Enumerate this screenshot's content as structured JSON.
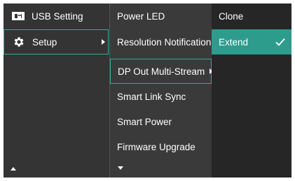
{
  "main_menu": {
    "items": [
      {
        "label": "USB Setting",
        "icon": "usb-setting-icon"
      },
      {
        "label": "Setup",
        "icon": "gear-icon"
      }
    ]
  },
  "setup_submenu": {
    "items": [
      {
        "label": "Power LED"
      },
      {
        "label": "Resolution Notification"
      },
      {
        "label": "DP Out Multi-Stream"
      },
      {
        "label": "Smart Link Sync"
      },
      {
        "label": "Smart Power"
      },
      {
        "label": "Firmware Upgrade"
      }
    ]
  },
  "options_menu": {
    "items": [
      {
        "label": "Clone"
      },
      {
        "label": "Extend",
        "selected": true
      }
    ]
  },
  "colors": {
    "panel": "#2f2f2f",
    "highlight": "#2e9c8d",
    "outline": "#35a89a",
    "text": "#ffffff"
  }
}
